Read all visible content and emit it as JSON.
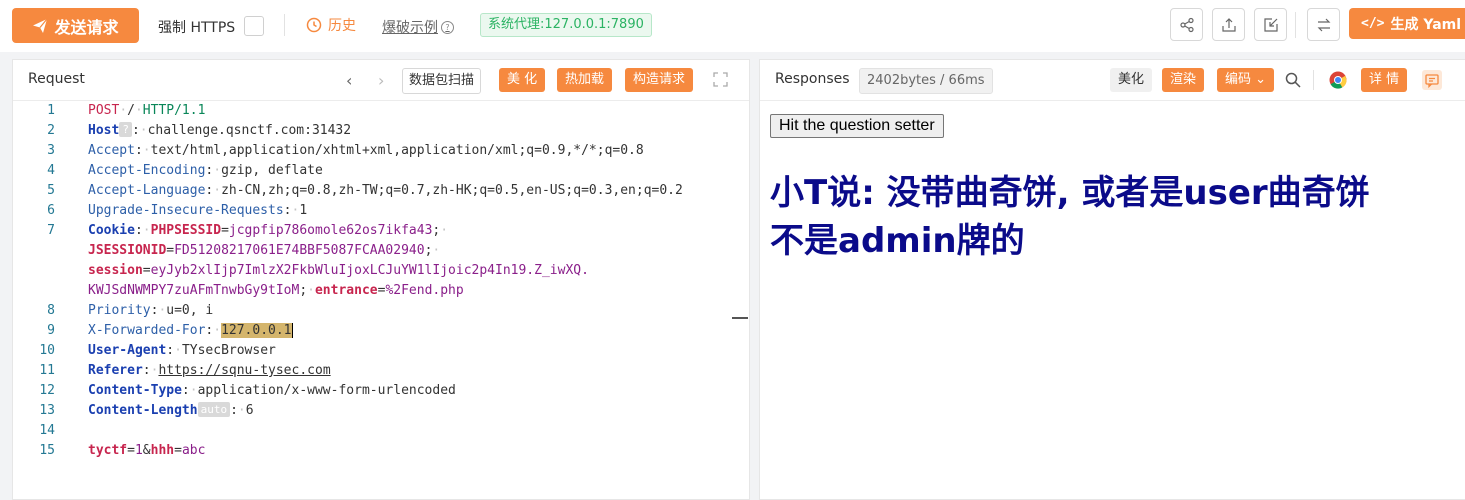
{
  "toolbar": {
    "send_label": "发送请求",
    "force_https_label": "强制 HTTPS",
    "history_label": "历史",
    "example_label": "爆破示例",
    "proxy_label": "系统代理:127.0.0.1:7890",
    "yaml_label": "生成 Yaml 模",
    "icons": [
      "share-icon",
      "export-icon",
      "import-icon",
      "swap-icon"
    ],
    "accent_color": "#f6893f"
  },
  "request": {
    "title": "Request",
    "scan_label": "数据包扫描",
    "beautify_label": "美 化",
    "hotload_label": "热加载",
    "build_label": "构造请求",
    "line_numbers": [
      "1",
      "2",
      "3",
      "4",
      "5",
      "6",
      "7",
      "",
      "",
      "",
      "8",
      "9",
      "10",
      "11",
      "12",
      "13",
      "14",
      "15"
    ],
    "method": "POST",
    "path": "/",
    "protocol": "HTTP/1.1",
    "headers": {
      "host_name": "Host",
      "host_value": "challenge.qsnctf.com:31432",
      "accept_name": "Accept",
      "accept_value": "text/html,application/xhtml+xml,application/xml;q=0.9,*/*;q=0.8",
      "encoding_name": "Accept-Encoding",
      "encoding_value": "gzip, deflate",
      "language_name": "Accept-Language",
      "language_value": "zh-CN,zh;q=0.8,zh-TW;q=0.7,zh-HK;q=0.5,en-US;q=0.3,en;q=0.2",
      "upgrade_name": "Upgrade-Insecure-Requests",
      "upgrade_value": "1",
      "cookie_name": "Cookie",
      "phpsessid_key": "PHPSESSID",
      "phpsessid_val": "jcgpfip786omole62os7ikfa43",
      "jsession_key": "JSESSIONID",
      "jsession_val": "FD51208217061E74BBF5087FCAA02940",
      "session_key": "session",
      "session_val_1": "eyJyb2xlIjp7ImlzX2FkbWluIjoxLCJuYW1lIjoic2p4In19.Z_iwXQ.",
      "session_val_2": "KWJSdNWMPY7zuAFmTnwbGy9tIoM",
      "entrance_key": "entrance",
      "entrance_val": "%2Fend.php",
      "priority_name": "Priority",
      "priority_value": "u=0, i",
      "xff_name": "X-Forwarded-For",
      "xff_value": "127.0.0.1",
      "ua_name": "User-Agent",
      "ua_value": "TYsecBrowser",
      "referer_name": "Referer",
      "referer_value": "https://sqnu-tysec.com",
      "ctype_name": "Content-Type",
      "ctype_value": "application/x-www-form-urlencoded",
      "clen_name": "Content-Length",
      "clen_badge": "auto",
      "clen_value": "6"
    },
    "body": {
      "k1": "tyctf",
      "v1": "1",
      "k2": "hhh",
      "v2": "abc"
    }
  },
  "response": {
    "title": "Responses",
    "size_label": "2402bytes / 66ms",
    "pretty_label": "美化",
    "render_label": "渲染",
    "encoding_label": "编码",
    "detail_label": "详 情",
    "button_label": "Hit the question setter",
    "message_line1": "小T说: 没带曲奇饼, 或者是user曲奇饼",
    "message_line2": "不是admin牌的"
  }
}
